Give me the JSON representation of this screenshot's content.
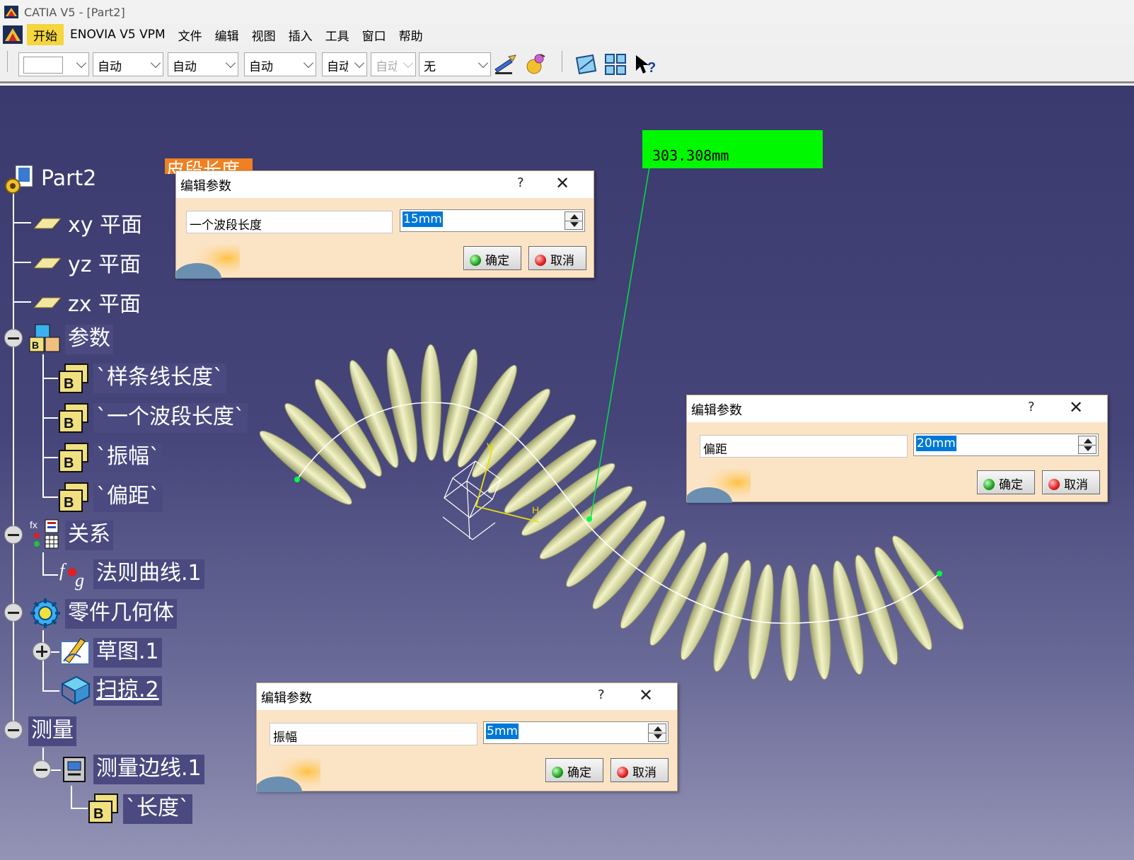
{
  "window": {
    "title": "CATIA V5 - [Part2]"
  },
  "menu": {
    "items": [
      {
        "label": "开始"
      },
      {
        "label": "ENOVIA V5 VPM"
      },
      {
        "label": "文件"
      },
      {
        "label": "编辑"
      },
      {
        "label": "视图"
      },
      {
        "label": "插入"
      },
      {
        "label": "工具"
      },
      {
        "label": "窗口"
      },
      {
        "label": "帮助"
      }
    ]
  },
  "toolbar": {
    "combos": [
      {
        "value": ""
      },
      {
        "value": "自动"
      },
      {
        "value": "自动"
      },
      {
        "value": "自动"
      },
      {
        "value": "自动"
      },
      {
        "value": "自动"
      },
      {
        "value": "无"
      }
    ],
    "icons": [
      "paint-brush-icon",
      "apply-material-icon",
      "plane-view-icon",
      "multi-view-icon",
      "whats-this-help-icon"
    ]
  },
  "tree": {
    "root": "Part2",
    "xy_plane": "xy 平面",
    "yz_plane": "yz 平面",
    "zx_plane": "zx 平面",
    "parameters": "参数",
    "param_spline_length": "`样条线长度`",
    "param_wave_length": "`一个波段长度`",
    "param_amplitude": "`振幅`",
    "param_offset": "`偏距`",
    "relations": "关系",
    "law_curve": "法则曲线.1",
    "part_body": "零件几何体",
    "sketch": "草图.1",
    "sweep": "扫掠.2",
    "measure": "测量",
    "measure_edge": "测量边线.1",
    "length": "`长度`"
  },
  "viewport": {
    "measure_value": "303.308mm",
    "orange_label": "皮段长度",
    "measure_color": "#00f800",
    "sweep_color": "#ecedb8"
  },
  "dialogs": {
    "wave": {
      "title": "编辑参数",
      "help": "?",
      "name": "一个波段长度",
      "value": "15mm",
      "ok": "确定",
      "cancel": "取消"
    },
    "offset": {
      "title": "编辑参数",
      "help": "?",
      "name": "偏距",
      "value": "20mm",
      "ok": "确定",
      "cancel": "取消"
    },
    "amplitude": {
      "title": "编辑参数",
      "help": "?",
      "name": "振幅",
      "value": "5mm",
      "ok": "确定",
      "cancel": "取消"
    }
  }
}
